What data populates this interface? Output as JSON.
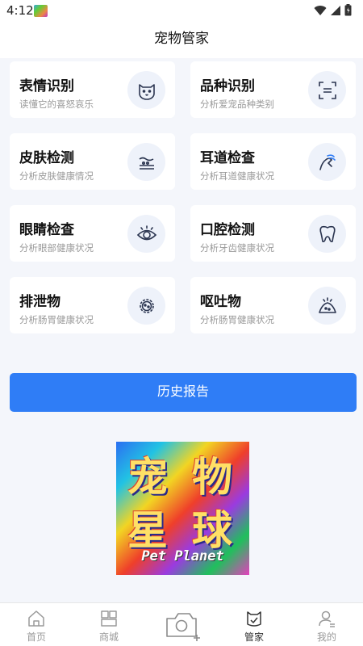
{
  "status": {
    "time": "4:12"
  },
  "header": {
    "title": "宠物管家"
  },
  "cards": [
    {
      "label": "表情识别",
      "sub": "读懂它的喜怒哀乐",
      "icon": "cat-face-icon"
    },
    {
      "label": "品种识别",
      "sub": "分析爱宠品种类别",
      "icon": "scan-icon"
    },
    {
      "label": "皮肤检测",
      "sub": "分析皮肤健康情况",
      "icon": "skin-icon"
    },
    {
      "label": "耳道检查",
      "sub": "分析耳道健康状况",
      "icon": "ear-icon"
    },
    {
      "label": "眼睛检查",
      "sub": "分析眼部健康状况",
      "icon": "eye-icon"
    },
    {
      "label": "口腔检测",
      "sub": "分析牙齿健康状况",
      "icon": "tooth-icon"
    },
    {
      "label": "排泄物",
      "sub": "分析肠胃健康状况",
      "icon": "gear-icon"
    },
    {
      "label": "呕吐物",
      "sub": "分析肠胃健康状况",
      "icon": "vomit-icon"
    }
  ],
  "history_button": "历史报告",
  "logo": {
    "glyphs": [
      "宠",
      "物",
      "星",
      "球"
    ],
    "english": "Pet Planet"
  },
  "nav": [
    {
      "label": "首页",
      "icon": "home-icon"
    },
    {
      "label": "商城",
      "icon": "shop-icon"
    },
    {
      "label": "管家",
      "icon": "butler-icon",
      "active": true
    },
    {
      "label": "我的",
      "icon": "profile-icon"
    }
  ],
  "colors": {
    "accent": "#2f7df6",
    "background": "#f4f6fb",
    "icon_stroke": "#2b3550"
  }
}
